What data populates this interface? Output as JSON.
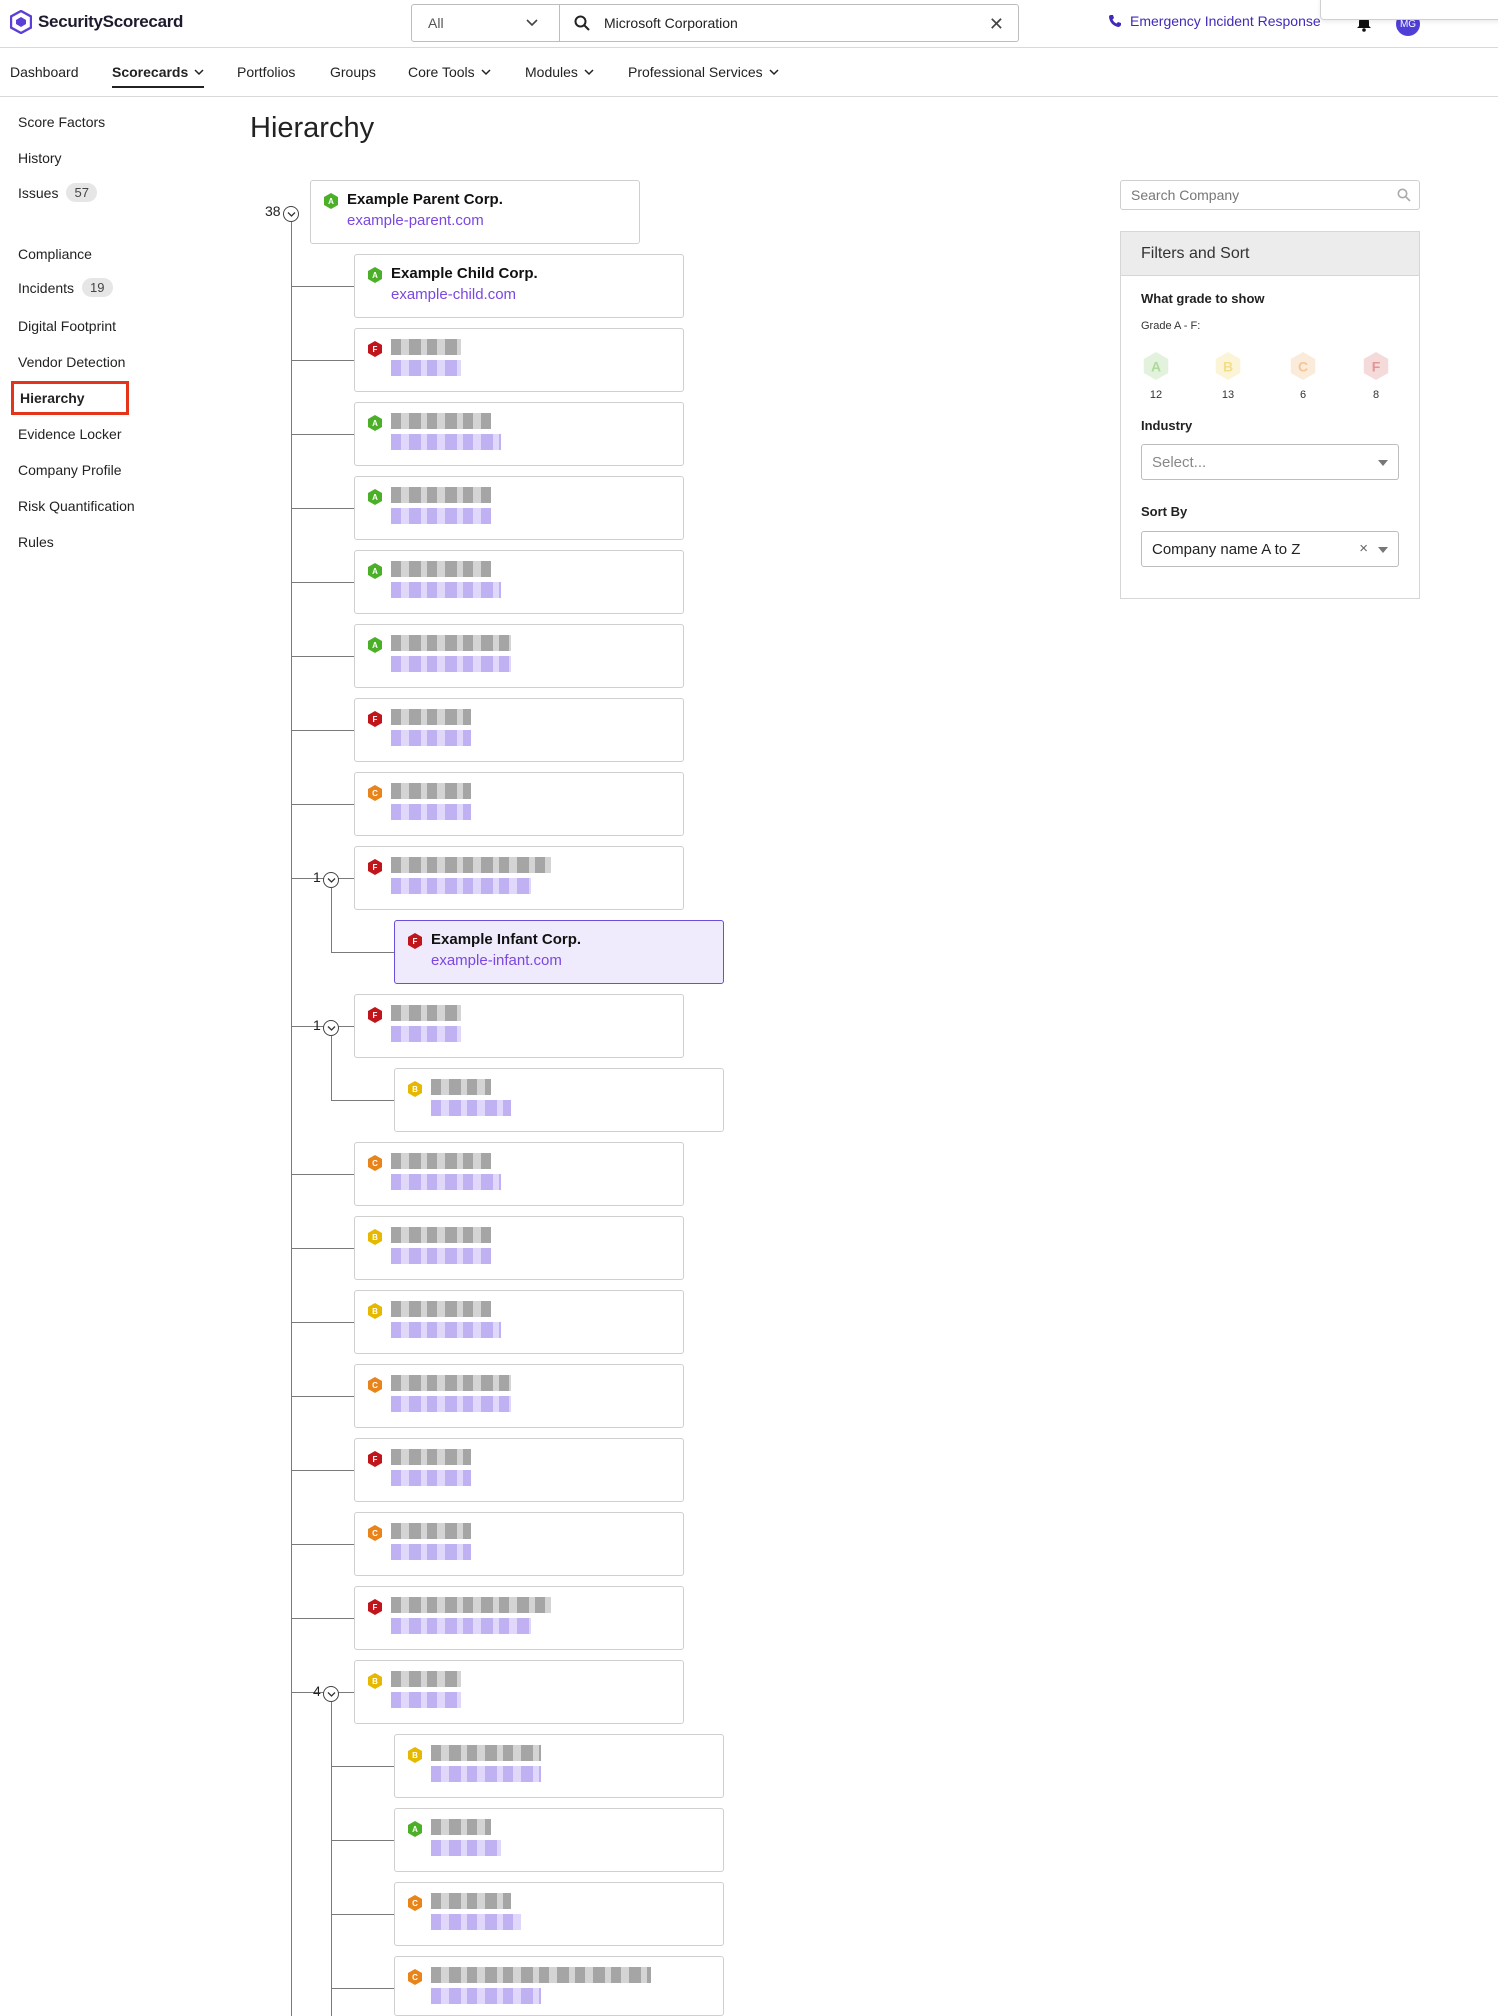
{
  "header": {
    "brand": "SecurityScorecard",
    "scope": "All",
    "search_value": "Microsoft Corporation",
    "emergency": "Emergency Incident Response",
    "avatar_initials": "MG",
    "brand_color": "#5b3fd6"
  },
  "nav": [
    "Dashboard",
    "Scorecards",
    "Portfolios",
    "Groups",
    "Core Tools",
    "Modules",
    "Professional Services"
  ],
  "sidebar": {
    "items": [
      {
        "label": "Score Factors"
      },
      {
        "label": "History"
      },
      {
        "label": "Issues",
        "badge": "57"
      },
      {
        "label": "Compliance"
      },
      {
        "label": "Incidents",
        "badge": "19"
      },
      {
        "label": "Digital Footprint"
      },
      {
        "label": "Vendor Detection"
      },
      {
        "label": "Hierarchy"
      },
      {
        "label": "Evidence Locker"
      },
      {
        "label": "Company Profile"
      },
      {
        "label": "Risk Quantification"
      },
      {
        "label": "Rules"
      }
    ]
  },
  "page": {
    "title": "Hierarchy"
  },
  "tree": {
    "root_count": "38",
    "root": {
      "name": "Example Parent Corp.",
      "domain": "example-parent.com",
      "grade": "A"
    },
    "child": {
      "name": "Example Child Corp.",
      "domain": "example-child.com",
      "grade": "A"
    },
    "infant": {
      "name": "Example Infant Corp.",
      "domain": "example-infant.com",
      "grade": "F"
    },
    "counts": [
      "1",
      "1",
      "4"
    ],
    "grades": [
      "F",
      "A",
      "A",
      "A",
      "A",
      "F",
      "C",
      "F",
      "F",
      "C",
      "B",
      "B",
      "C",
      "F",
      "C",
      "F",
      "B",
      "B",
      "B",
      "A",
      "C",
      "C",
      "A"
    ]
  },
  "right": {
    "search_placeholder": "Search Company",
    "filters_title": "Filters and Sort",
    "grade_label": "What grade to show",
    "grade_range": "Grade A - F:",
    "grade_counts": [
      {
        "grade": "A",
        "count": "12"
      },
      {
        "grade": "B",
        "count": "13"
      },
      {
        "grade": "C",
        "count": "6"
      },
      {
        "grade": "F",
        "count": "8"
      }
    ],
    "industry_label": "Industry",
    "industry_placeholder": "Select...",
    "sort_label": "Sort By",
    "sort_value": "Company name A to Z"
  },
  "colors": {
    "A": "#4caf28",
    "B": "#e6b800",
    "C": "#e8841a",
    "F": "#c0161b",
    "link": "#7b47e0"
  }
}
